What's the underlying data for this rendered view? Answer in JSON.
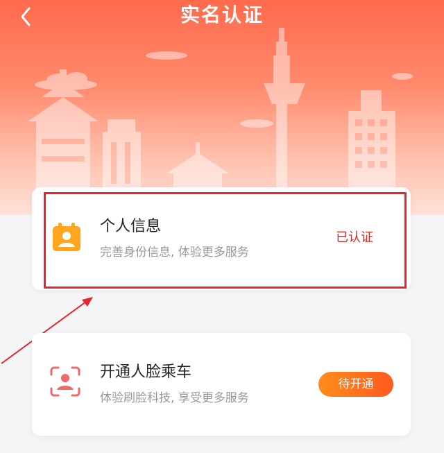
{
  "header": {
    "title": "实名认证",
    "back_icon": "chevron-left-icon"
  },
  "colors": {
    "header_gradient_top": "#ff6a4c",
    "header_gradient_bottom": "#ffe2d8",
    "verified_text": "#c9302c",
    "button_gradient_start": "#ff8c1a",
    "button_gradient_end": "#ff5a1f",
    "highlight_border": "#e4252b"
  },
  "cards": [
    {
      "icon": "user-calendar-icon",
      "title": "个人信息",
      "subtitle": "完善身份信息, 体验更多服务",
      "status": "已认证"
    },
    {
      "icon": "face-scan-icon",
      "title": "开通人脸乘车",
      "subtitle": "体验刷脸科技, 享受更多服务",
      "action_label": "待开通"
    }
  ]
}
